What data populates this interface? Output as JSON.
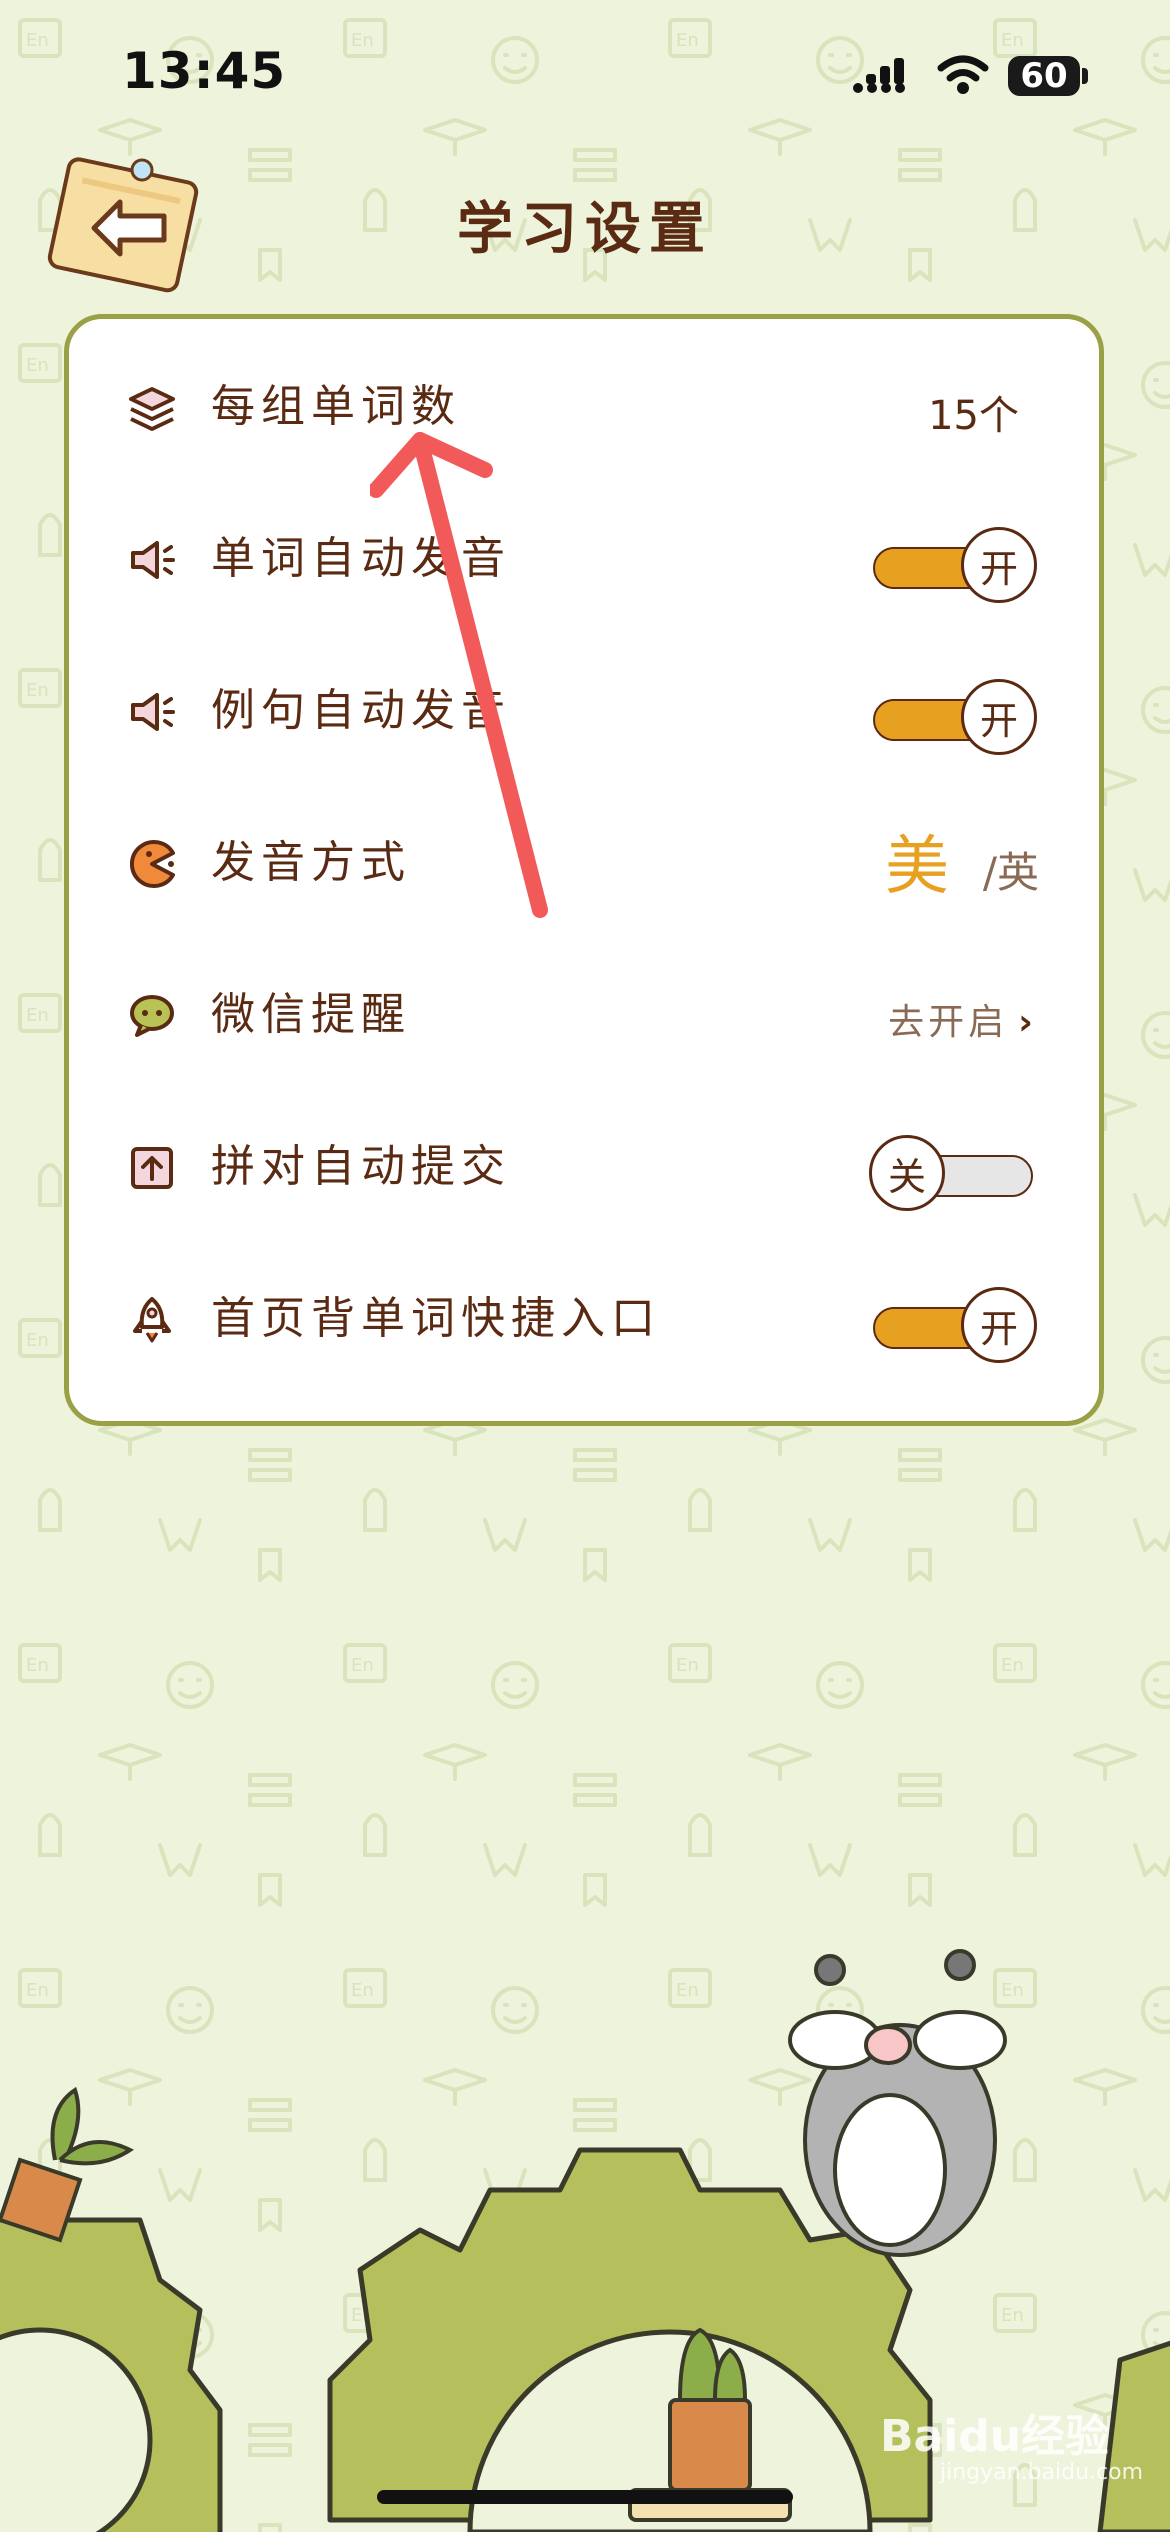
{
  "status_bar": {
    "time": "13:45",
    "battery": "60"
  },
  "header": {
    "title": "学习设置"
  },
  "settings": {
    "words_per_group": {
      "label": "每组单词数",
      "value": "15个"
    },
    "word_auto_pronounce": {
      "label": "单词自动发音",
      "state": "开"
    },
    "sentence_auto_pronounce": {
      "label": "例句自动发音",
      "state": "开"
    },
    "pronunciation": {
      "label": "发音方式",
      "selected": "美",
      "other": "/英"
    },
    "wechat_reminder": {
      "label": "微信提醒",
      "action": "去开启"
    },
    "spell_auto_submit": {
      "label": "拼对自动提交",
      "state": "关"
    },
    "home_shortcut": {
      "label": "首页背单词快捷入口",
      "state": "开"
    }
  },
  "watermark": {
    "brand": "Baidu经验",
    "url": "jingyan.baidu.com"
  },
  "colors": {
    "accent": "#e8a020",
    "text": "#5a2a12",
    "card_border": "#9aa046",
    "background": "#eef3dc",
    "annotation": "#f25a5a"
  }
}
